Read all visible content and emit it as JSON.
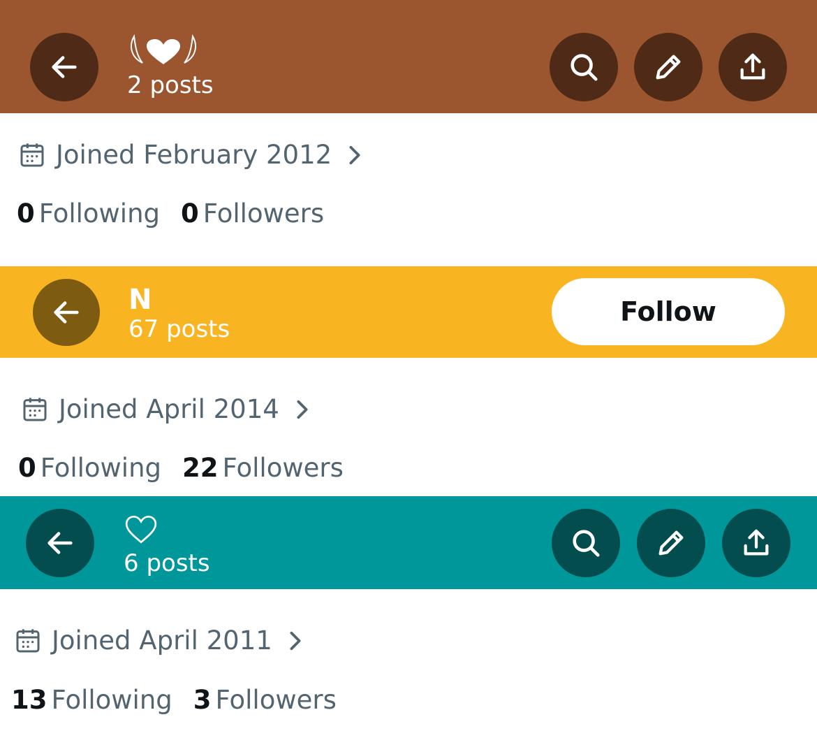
{
  "profiles": [
    {
      "header": {
        "bg_color": "#9b5630",
        "button_color": "#4e2a17",
        "name_icon": "winged-heart-icon",
        "posts": "2 posts",
        "actions": [
          "search-icon",
          "pencil-icon",
          "share-icon"
        ]
      },
      "joined": "Joined February 2012",
      "following_count": "0",
      "following_label": "Following",
      "followers_count": "0",
      "followers_label": "Followers"
    },
    {
      "header": {
        "bg_color": "#f8b521",
        "button_color": "#7d5b11",
        "name": "N",
        "posts": "67 posts",
        "follow_label": "Follow"
      },
      "joined": "Joined April 2014",
      "following_count": "0",
      "following_label": "Following",
      "followers_count": "22",
      "followers_label": "Followers"
    },
    {
      "header": {
        "bg_color": "#00979a",
        "button_color": "#044d4e",
        "name_icon": "heart-outline-icon",
        "posts": "6 posts",
        "actions": [
          "search-icon",
          "pencil-icon",
          "share-icon"
        ]
      },
      "joined": "Joined April 2011",
      "following_count": "13",
      "following_label": "Following",
      "followers_count": "3",
      "followers_label": "Followers"
    }
  ]
}
